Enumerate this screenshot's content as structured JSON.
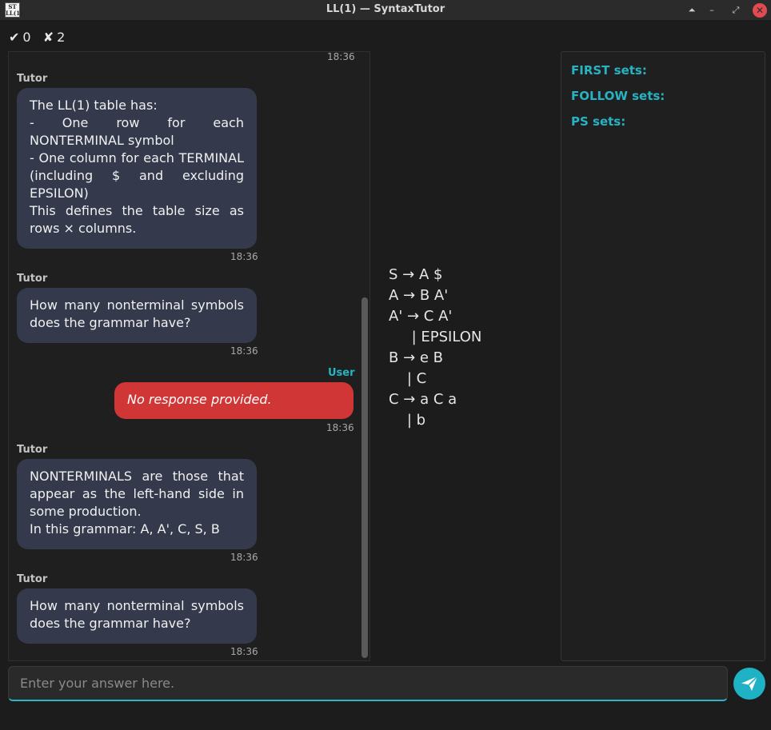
{
  "window": {
    "icon_text": "ST\nLL(1)",
    "title": "LL(1) — SyntaxTutor",
    "buttons": [
      "⏶",
      "–",
      "⤢",
      "✕"
    ]
  },
  "score": {
    "correct_icon": "✔",
    "correct": "0",
    "wrong_icon": "✘",
    "wrong": "2"
  },
  "chat": {
    "top_time": "18:36",
    "messages": [
      {
        "sender": "Tutor",
        "text": "The LL(1) table has:\n - One row for each NONTERMINAL symbol\n - One column for each TERMINAL (including $ and excluding EPSILON)\nThis defines the table size as rows × columns.",
        "time": "18:36"
      },
      {
        "sender": "Tutor",
        "text": "How many nonterminal symbols does the grammar have?",
        "time": "18:36"
      },
      {
        "sender": "User",
        "text": "No response provided.",
        "time": "18:36"
      },
      {
        "sender": "Tutor",
        "text": "NONTERMINALS are those that appear as the left-hand side in some production.\nIn this grammar: A, A', C, S, B",
        "time": "18:36"
      },
      {
        "sender": "Tutor",
        "text": "How many nonterminal symbols does the grammar have?",
        "time": "18:36"
      }
    ]
  },
  "grammar": {
    "lines": [
      "S → A $",
      "A → B A'",
      "A' → C A'",
      "     | EPSILON",
      "B → e B",
      "    | C",
      "C → a C a",
      "    | b"
    ]
  },
  "sets": {
    "first_label": "FIRST sets:",
    "follow_label": "FOLLOW sets:",
    "ps_label": "PS sets:"
  },
  "input": {
    "placeholder": "Enter your answer here.",
    "value": ""
  },
  "colors": {
    "accent": "#1fb2c4",
    "tutor_bubble": "#343a4c",
    "user_bubble": "#d13636"
  },
  "icons": {
    "send": "send-icon"
  }
}
